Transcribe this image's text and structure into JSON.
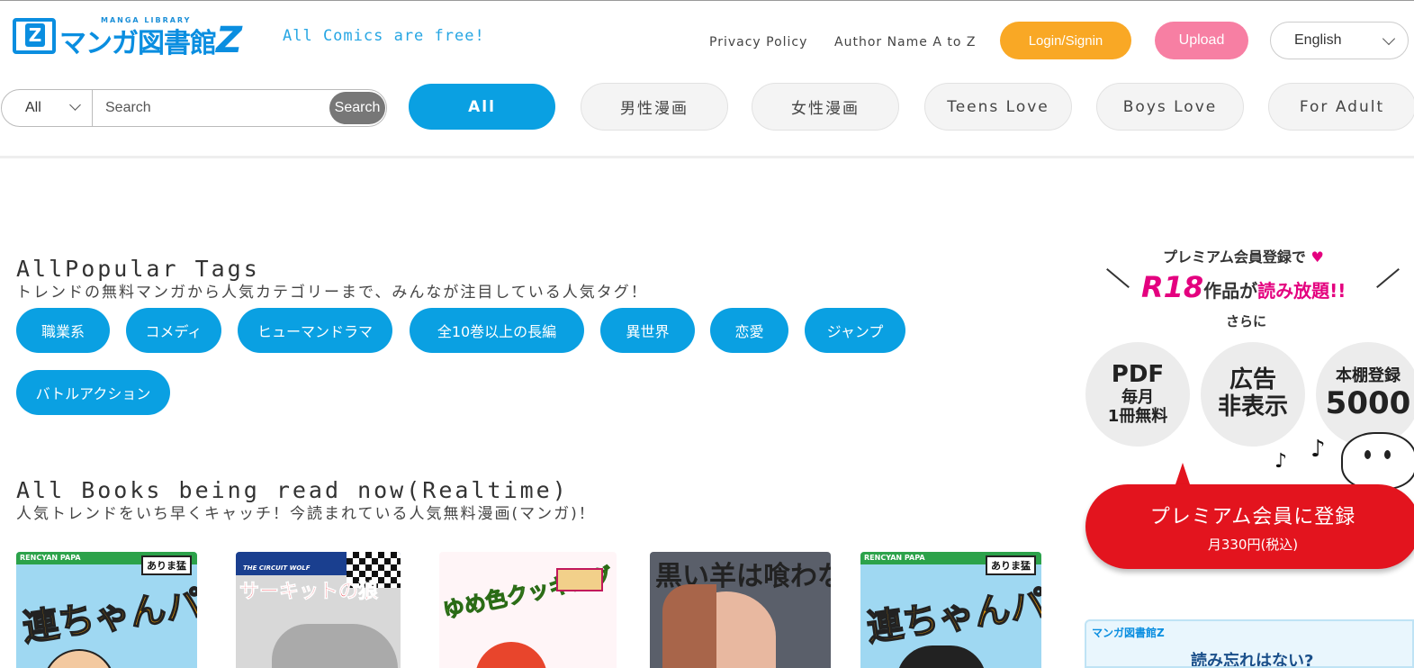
{
  "header": {
    "logo_small": "MANGA LIBRARY",
    "logo_box_letter": "Z",
    "logo_text": "マンガ図書館",
    "logo_z": "Z",
    "tagline": "All Comics are free!",
    "privacy": "Privacy Policy",
    "author": "Author Name A to Z",
    "login": "Login/Signin",
    "upload": "Upload",
    "language": "English"
  },
  "search": {
    "category": "All",
    "placeholder": "Search",
    "button": "Search"
  },
  "categories": [
    "All",
    "男性漫画",
    "女性漫画",
    "Teens Love",
    "Boys Love",
    "For Adult"
  ],
  "popular": {
    "title": "AllPopular Tags",
    "subtitle": "トレンドの無料マンガから人気カテゴリーまで、みんなが注目している人気タグ！",
    "tags": [
      "職業系",
      "コメディ",
      "ヒューマンドラマ",
      "全10巻以上の長編",
      "異世界",
      "恋愛",
      "ジャンプ",
      "バトルアクション"
    ]
  },
  "reading": {
    "title": "All Books being read now(Realtime)",
    "subtitle": "人気トレンドをいち早くキャッチ！今読まれている人気無料漫画(マンガ)！",
    "books": [
      {
        "band": "RENCYAN PAPA",
        "author": "ありま猛",
        "title": "連ちゃんパパ"
      },
      {
        "band": "THE CIRCUIT WOLF",
        "author": "",
        "title": "サーキットの狼"
      },
      {
        "band": "",
        "author": "",
        "title": "ゆめ色クッキング"
      },
      {
        "band": "",
        "author": "",
        "title": "黒い羊は喰わない"
      },
      {
        "band": "RENCYAN PAPA",
        "author": "ありま猛",
        "title": "連ちゃんパパ"
      }
    ]
  },
  "ad": {
    "line1": "プレミアム会員登録で",
    "heart": "♥",
    "r18": "R18",
    "line2a": "作品が",
    "line2b": "読み放題!!",
    "line3": "さらに",
    "c1a": "PDF",
    "c1b": "毎月",
    "c1c": "1冊無料",
    "c2a": "広告",
    "c2b": "非表示",
    "c3a": "本棚登録",
    "c3b": "5000",
    "cta": "プレミアム会員に登録",
    "price": "月330円(税込)",
    "note1": "♪",
    "note2": "♪"
  },
  "banner2": {
    "logo": "マンガ図書館Z",
    "text": "読み忘れはない?"
  },
  "colors": {
    "accent": "#0aa0e2",
    "login": "#f9a825",
    "upload": "#f77fa3",
    "cta": "#e3141e",
    "pink": "#e4007f"
  }
}
